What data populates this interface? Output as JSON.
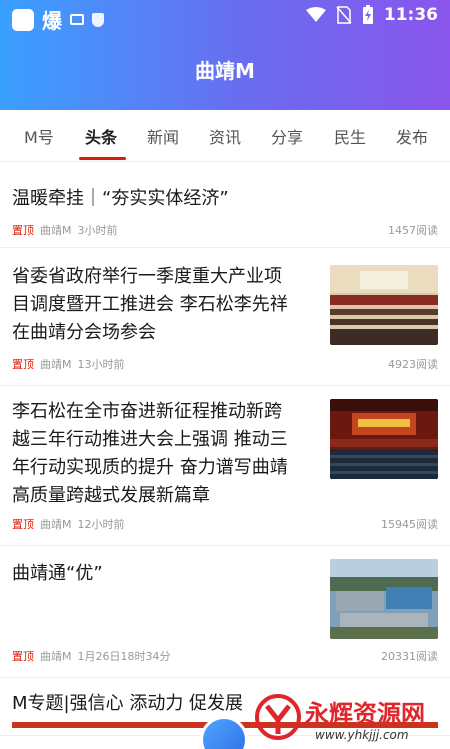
{
  "status_bar": {
    "time": "11:36",
    "notif_text": "爆",
    "icons": [
      "app-icon",
      "mail-icon",
      "shield-icon",
      "wifi-icon",
      "no-sim-icon",
      "battery-charging-icon"
    ]
  },
  "header": {
    "title": "曲靖M"
  },
  "tabs": [
    {
      "label": "M号"
    },
    {
      "label": "头条",
      "active": true
    },
    {
      "label": "新闻"
    },
    {
      "label": "资讯"
    },
    {
      "label": "分享"
    },
    {
      "label": "民生"
    },
    {
      "label": "发布"
    }
  ],
  "feed": [
    {
      "title": "温暖牵挂｜“夯实实体经济”",
      "pinned": "置顶",
      "source": "曲靖M",
      "time": "3小时前",
      "reads": "1457阅读"
    },
    {
      "title_lines": [
        "省委省政府举行一季度重大产业项",
        "目调度暨开工推进会 李石松李先祥",
        "在曲靖分会场参会"
      ],
      "pinned": "置顶",
      "source": "曲靖M",
      "time": "13小时前",
      "reads": "4923阅读",
      "thumb": "conference-room-photo"
    },
    {
      "title_lines": [
        "李石松在全市奋进新征程推动新跨",
        "越三年行动推进大会上强调 推动三",
        "年行动实现质的提升 奋力谱写曲靖",
        "高质量跨越式发展新篇章"
      ],
      "pinned": "置顶",
      "source": "曲靖M",
      "time": "12小时前",
      "reads": "15945阅读",
      "thumb": "meeting-hall-photo"
    },
    {
      "title": "曲靖通“优”",
      "pinned": "置顶",
      "source": "曲靖M",
      "time": "1月26日18时34分",
      "reads": "20331阅读",
      "thumb": "industrial-park-photo"
    },
    {
      "title": "M专题|强信心 添动力 促发展"
    }
  ],
  "watermark": {
    "text": "永辉资源网",
    "url": "www.yhkjjj.com"
  },
  "colors": {
    "accent": "#d81e06",
    "header_start": "#3aa0ff",
    "header_end": "#8a55ec"
  }
}
